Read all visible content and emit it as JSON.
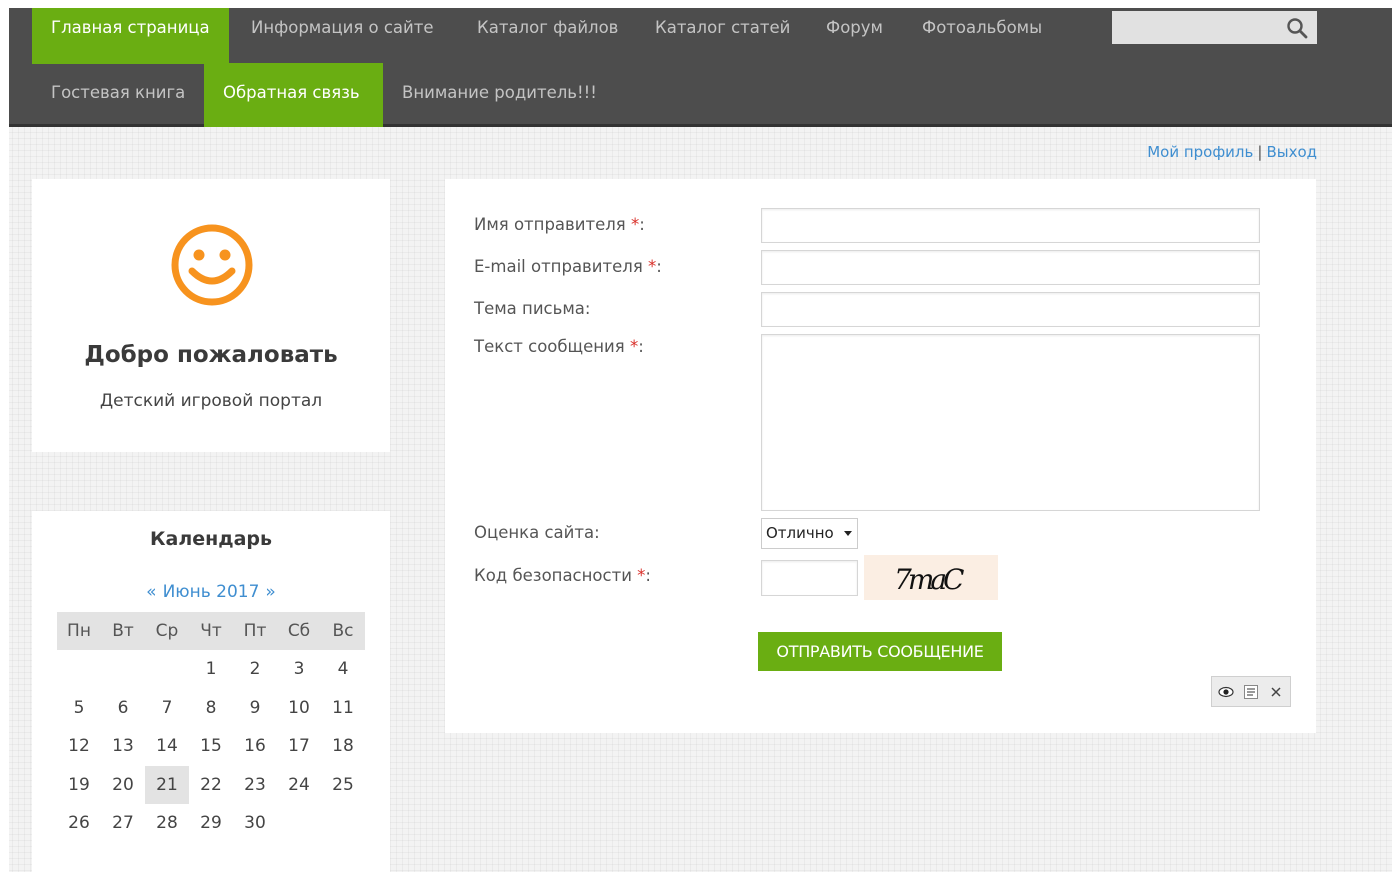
{
  "nav": {
    "row1": [
      {
        "label": "Главная страница",
        "active": true
      },
      {
        "label": "Информация о сайте",
        "active": false
      },
      {
        "label": "Каталог файлов",
        "active": false
      },
      {
        "label": "Каталог статей",
        "active": false
      },
      {
        "label": "Форум",
        "active": false
      },
      {
        "label": "Фотоальбомы",
        "active": false
      }
    ],
    "row2": [
      {
        "label": "Гостевая книга",
        "active": false
      },
      {
        "label": "Обратная связь",
        "active": true
      },
      {
        "label": "Внимание родитель!!!",
        "active": false
      }
    ],
    "search": {
      "value": "",
      "icon": "search-icon"
    }
  },
  "user_links": {
    "profile": "Мой профиль",
    "separator": "|",
    "logout": "Выход"
  },
  "welcome": {
    "icon": "smiley-icon",
    "title": "Добро пожаловать",
    "subtitle": "Детский игровой портал"
  },
  "calendar": {
    "title": "Календарь",
    "prev": "«",
    "month": "Июнь 2017",
    "next": "»",
    "weekdays": [
      "Пн",
      "Вт",
      "Ср",
      "Чт",
      "Пт",
      "Сб",
      "Вс"
    ],
    "weeks": [
      [
        "",
        "",
        "",
        "1",
        "2",
        "3",
        "4"
      ],
      [
        "5",
        "6",
        "7",
        "8",
        "9",
        "10",
        "11"
      ],
      [
        "12",
        "13",
        "14",
        "15",
        "16",
        "17",
        "18"
      ],
      [
        "19",
        "20",
        "21",
        "22",
        "23",
        "24",
        "25"
      ],
      [
        "26",
        "27",
        "28",
        "29",
        "30",
        "",
        ""
      ]
    ],
    "today": "21"
  },
  "form": {
    "sender_name_label": "Имя отправителя ",
    "sender_email_label": "E-mail отправителя ",
    "subject_label": "Тема письма:",
    "message_label": "Текст сообщения ",
    "rating_label": "Оценка сайта:",
    "rating_value": "Отлично",
    "captcha_label": "Код безопасности ",
    "captcha_text": "7maC",
    "required_mark": "*",
    "colon": ":",
    "submit": "ОТПРАВИТЬ СООБЩЕНИЕ",
    "tools": [
      "eye-icon",
      "list-icon",
      "close-icon"
    ]
  },
  "colors": {
    "accent": "#6aae12",
    "nav_bg": "#4d4d4d",
    "link": "#3f8ed0",
    "required": "#d9302a",
    "smiley": "#f7931e"
  }
}
